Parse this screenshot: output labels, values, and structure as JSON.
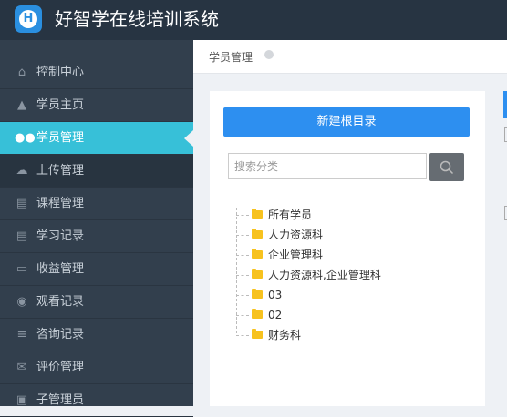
{
  "app": {
    "logo_letter": "H",
    "title": "好智学在线培训系统"
  },
  "sidebar": {
    "items": [
      {
        "label": "控制中心",
        "icon": "home-icon",
        "glyph": "⌂"
      },
      {
        "label": "学员主页",
        "icon": "graduation-cap-icon",
        "glyph": "🎓"
      },
      {
        "label": "学员管理",
        "icon": "users-icon",
        "glyph": "👥",
        "active": true
      },
      {
        "label": "上传管理",
        "icon": "cloud-upload-icon",
        "glyph": "☁"
      },
      {
        "label": "课程管理",
        "icon": "book-icon",
        "glyph": "▤"
      },
      {
        "label": "学习记录",
        "icon": "book-icon",
        "glyph": "▤"
      },
      {
        "label": "收益管理",
        "icon": "credit-card-icon",
        "glyph": "▭"
      },
      {
        "label": "观看记录",
        "icon": "eye-icon",
        "glyph": "◉"
      },
      {
        "label": "咨询记录",
        "icon": "list-icon",
        "glyph": "≡"
      },
      {
        "label": "评价管理",
        "icon": "comments-icon",
        "glyph": "✉"
      },
      {
        "label": "子管理员",
        "icon": "lock-icon",
        "glyph": "🔒"
      }
    ]
  },
  "breadcrumb": {
    "current": "学员管理"
  },
  "panel": {
    "new_button_label": "新建根目录",
    "search_placeholder": "搜索分类",
    "search_icon": "search-icon",
    "tree": [
      "所有学员",
      "人力资源科",
      "企业管理科",
      "人力资源科,企业管理科",
      "03",
      "02",
      "财务科"
    ]
  }
}
